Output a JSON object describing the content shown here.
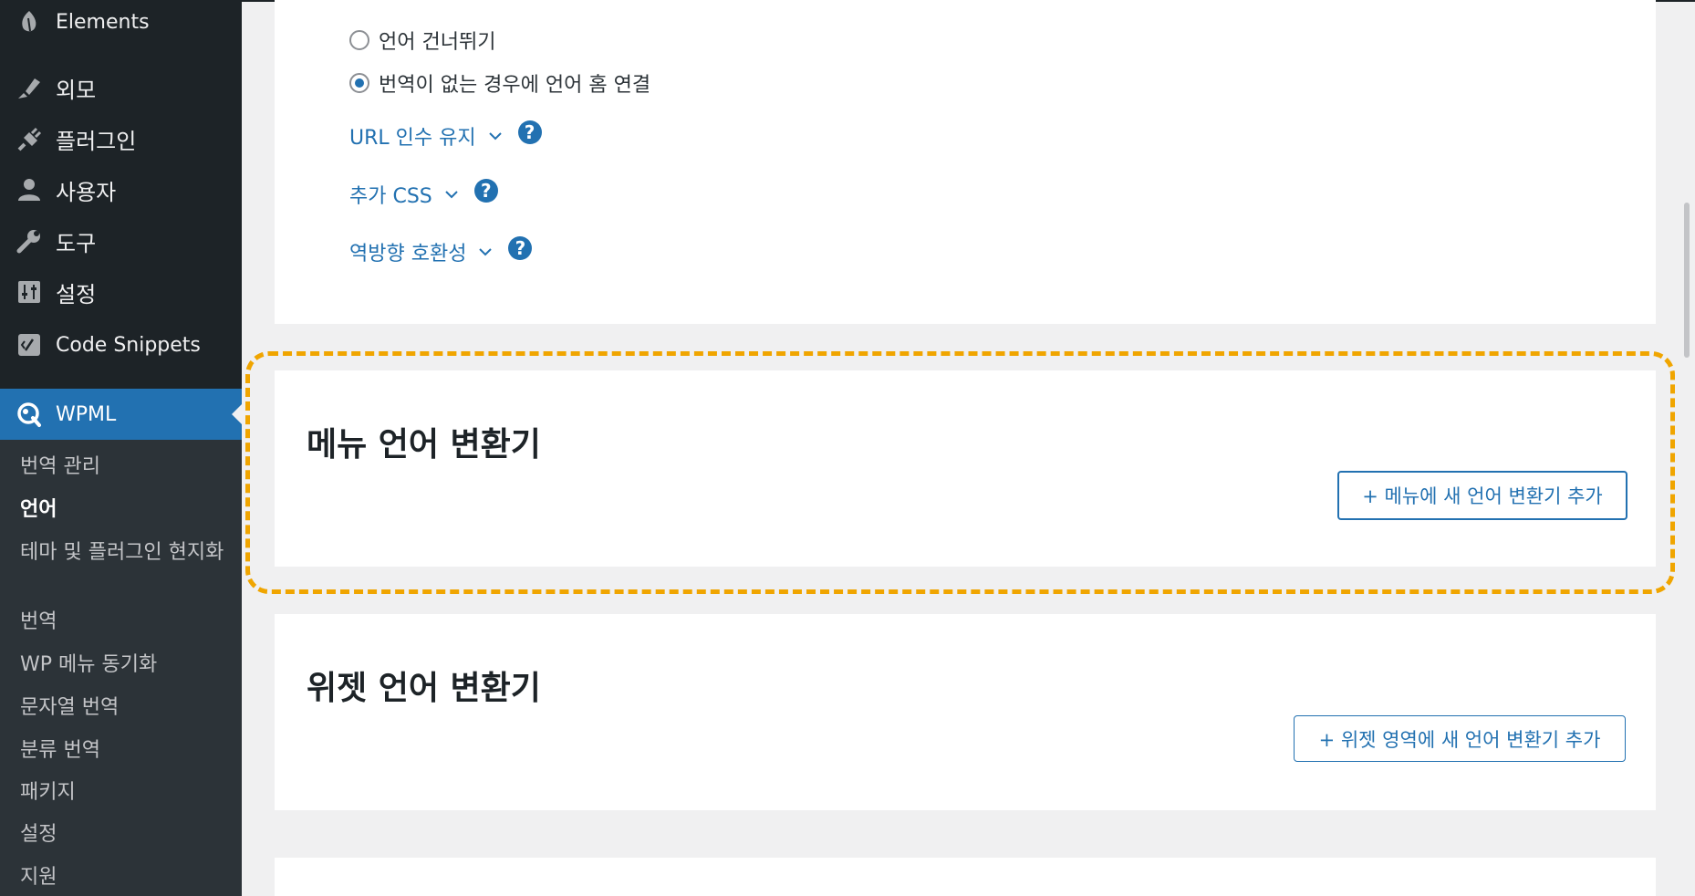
{
  "sidebar": {
    "elements_label": "Elements",
    "items": [
      {
        "label": "외모",
        "icon": "paintbrush-icon"
      },
      {
        "label": "플러그인",
        "icon": "plugin-icon"
      },
      {
        "label": "사용자",
        "icon": "user-icon"
      },
      {
        "label": "도구",
        "icon": "wrench-icon"
      },
      {
        "label": "설정",
        "icon": "settings-sliders-icon"
      },
      {
        "label": "Code Snippets",
        "icon": "code-snippets-icon"
      }
    ],
    "wpml_label": "WPML",
    "submenu": [
      "번역 관리",
      "언어",
      "테마 및 플러그인 현지화",
      "번역",
      "WP 메뉴 동기화",
      "문자열 번역",
      "분류 번역",
      "패키지",
      "설정",
      "지원"
    ],
    "current_submenu": "언어"
  },
  "options": {
    "radio_skip": "언어 건너뛰기",
    "radio_link_home": "번역이 없는 경우에 언어 홈 연결",
    "radio_selected": "radio_link_home",
    "toggle_url": "URL 인수 유지",
    "toggle_css": "추가 CSS",
    "toggle_compat": "역방향 호환성",
    "help_glyph": "?"
  },
  "menu_switcher": {
    "title": "메뉴 언어 변환기",
    "button": "+ 메뉴에 새 언어 변환기 추가"
  },
  "widget_switcher": {
    "title": "위젯 언어 변환기",
    "button": "+ 위젯 영역에 새 언어 변환기 추가"
  },
  "colors": {
    "sidebar_bg": "#1d2327",
    "accent": "#2271b1",
    "highlight": "#f0a500"
  }
}
